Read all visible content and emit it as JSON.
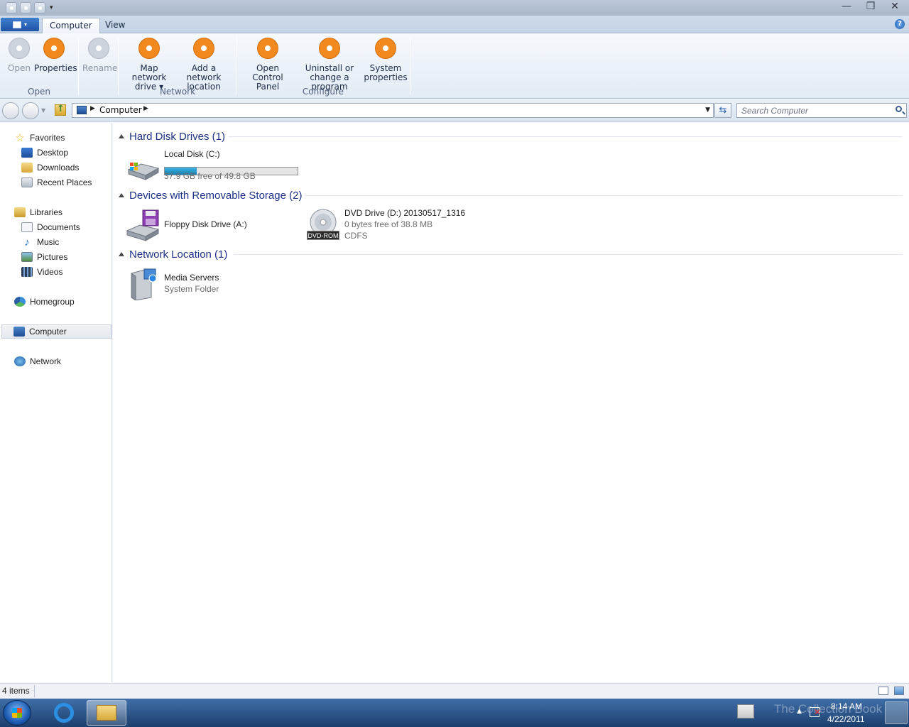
{
  "window": {
    "title": "",
    "controls": {
      "minimize": "—",
      "maximize": "❐",
      "close": "✕"
    }
  },
  "ribbon_tabs": [
    {
      "label": "Computer",
      "active": true
    },
    {
      "label": "View",
      "active": false
    }
  ],
  "ribbon": {
    "groups": [
      {
        "label": "Open",
        "buttons": [
          {
            "label": "Open",
            "enabled": false,
            "icon": "open-icon"
          },
          {
            "label": "Properties",
            "enabled": true,
            "icon": "properties-icon"
          }
        ]
      },
      {
        "label": "",
        "buttons": [
          {
            "label": "Rename",
            "enabled": false,
            "icon": "rename-icon"
          }
        ]
      },
      {
        "label": "Network",
        "buttons": [
          {
            "label_line1": "Map network",
            "label_line2": "drive ▾",
            "enabled": true,
            "icon": "map-network-drive-icon"
          },
          {
            "label_line1": "Add a network",
            "label_line2": "location",
            "enabled": true,
            "icon": "add-network-location-icon"
          }
        ]
      },
      {
        "label": "Configure",
        "buttons": [
          {
            "label_line1": "Open Control",
            "label_line2": "Panel",
            "enabled": true,
            "icon": "control-panel-icon"
          },
          {
            "label_line1": "Uninstall or",
            "label_line2": "change a program",
            "enabled": true,
            "icon": "uninstall-icon"
          },
          {
            "label_line1": "System",
            "label_line2": "properties",
            "enabled": true,
            "icon": "system-properties-icon"
          }
        ]
      }
    ]
  },
  "address": {
    "path": "Computer",
    "search_placeholder": "Search Computer"
  },
  "nav": {
    "favorites": {
      "label": "Favorites",
      "items": [
        "Desktop",
        "Downloads",
        "Recent Places"
      ]
    },
    "libraries": {
      "label": "Libraries",
      "items": [
        "Documents",
        "Music",
        "Pictures",
        "Videos"
      ]
    },
    "homegroup": "Homegroup",
    "computer": "Computer",
    "network": "Network"
  },
  "content": {
    "groups": [
      {
        "title": "Hard Disk Drives (1)",
        "items": [
          {
            "name": "Local Disk (C:)",
            "detail": "37.9 GB free of 49.8 GB",
            "used_fraction": 0.239,
            "icon": "hard-disk-icon"
          }
        ]
      },
      {
        "title": "Devices with Removable Storage (2)",
        "items": [
          {
            "name": "Floppy Disk Drive (A:)",
            "icon": "floppy-drive-icon"
          },
          {
            "name": "DVD Drive (D:) 20130517_1316",
            "detail": "0 bytes free of 38.8 MB",
            "detail2": "CDFS",
            "icon": "dvd-drive-icon",
            "badge": "DVD-ROM"
          }
        ]
      },
      {
        "title": "Network Location (1)",
        "items": [
          {
            "name": "Media Servers",
            "detail": "System Folder",
            "icon": "media-server-icon"
          }
        ]
      }
    ]
  },
  "status": {
    "items_count": "4 items"
  },
  "taskbar": {
    "clock_time": "8:14 AM",
    "clock_date": "4/22/2011",
    "watermark": "The Collection Book"
  },
  "colors": {
    "accent": "#1e3287",
    "ribbon_icon": "#f2891f",
    "capacity_fill": "#1582b6",
    "taskbar": "#1c3f6d"
  }
}
